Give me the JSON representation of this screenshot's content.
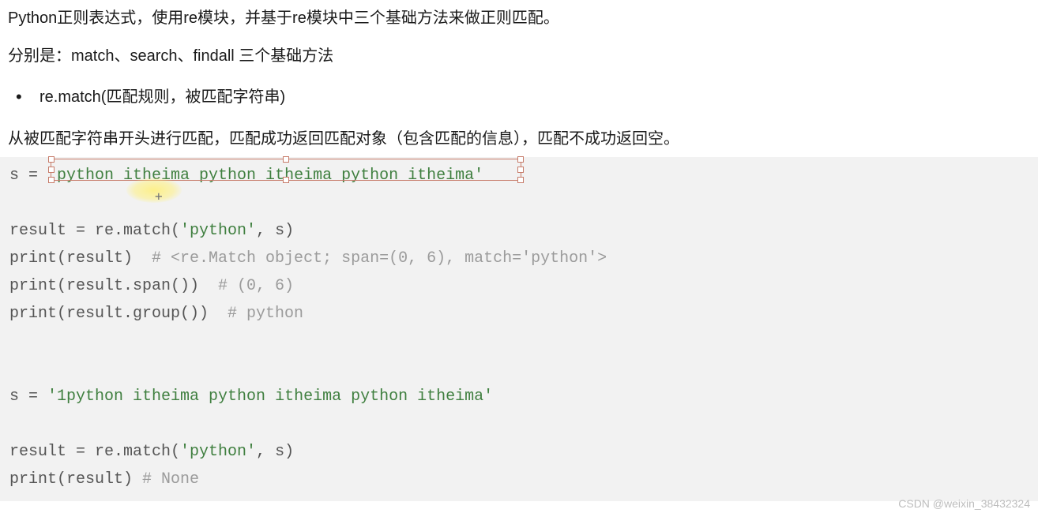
{
  "intro": {
    "p1": "Python正则表达式，使用re模块，并基于re模块中三个基础方法来做正则匹配。",
    "p2": "分别是：match、search、findall 三个基础方法",
    "bullet": "re.match(匹配规则，被匹配字符串)",
    "p4": "从被匹配字符串开头进行匹配，匹配成功返回匹配对象（包含匹配的信息），匹配不成功返回空。"
  },
  "code": {
    "l1_a": "s = ",
    "l1_b": "'python itheima python itheima python itheima'",
    "blank1": "",
    "l2_a": "result = re.match(",
    "l2_b": "'python'",
    "l2_c": ", s)",
    "l3_a": "print(result)  ",
    "l3_b": "# <re.Match object; span=(0, 6), match='python'>",
    "l4_a": "print(result.span())  ",
    "l4_b": "# (0, 6)",
    "l5_a": "print(result.group())  ",
    "l5_b": "# python",
    "blank2": "",
    "blank3": "",
    "l6_a": "s = ",
    "l6_b": "'1python itheima python itheima python itheima'",
    "blank4": "",
    "l7_a": "result = re.match(",
    "l7_b": "'python'",
    "l7_c": ", s)",
    "l8_a": "print(result) ",
    "l8_b": "# None"
  },
  "watermark": "CSDN @weixin_38432324"
}
